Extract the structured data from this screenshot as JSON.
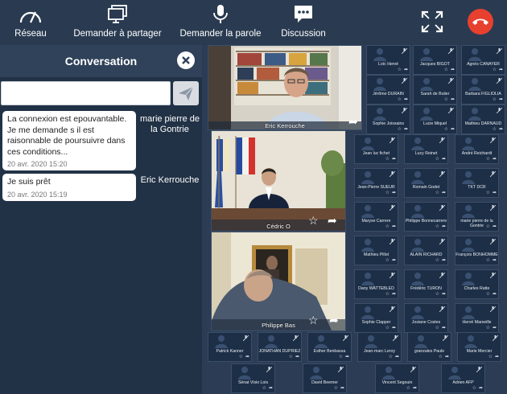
{
  "toolbar": {
    "network": "Réseau",
    "share": "Demander à partager",
    "speak": "Demander la parole",
    "discussion": "Discussion",
    "fullscreen_icon": "expand-icon",
    "hangup_icon": "hangup-phone-icon",
    "hangup_color": "#e8402f"
  },
  "chat": {
    "title": "Conversation",
    "input_value": "",
    "messages": [
      {
        "text": "La connexion est epouvantable. Je me demande s il est raisonnable de poursuivre dans ces conditions...",
        "time": "20 avr. 2020 15:20",
        "author": "marie pierre de la Gontrie"
      },
      {
        "text": "Je suis prêt",
        "time": "20 avr. 2020 15:19",
        "author": "Eric Kerrouche"
      }
    ]
  },
  "videos": {
    "featured": [
      {
        "name": "Eric Kerrouche"
      },
      {
        "name": "Cédric O"
      },
      {
        "name": "Philippe Bas"
      }
    ],
    "participants": [
      "Loïc Hervé",
      "Jacques BIGOT",
      "Agnès CANAYER",
      "Jérôme DURAIN",
      "Sarah de Bulier",
      "Barbara FIGLIOLIA",
      "Sophie Joissains",
      "Lucie Miquel",
      "Mathieu DARNAUD",
      "Jean luc fichet",
      "Lucy Reinet",
      "André Reichardt",
      "Jean-Pierre SUEUR",
      "Romain Godet",
      "TKT DCR",
      "Maryse Carrere",
      "Philippe Bonnecarrere",
      "marie pierre de la Gontrie",
      "Mathieu Pillot",
      "ALAIN RICHARD",
      "François BONHOMME",
      "Dany WATTEBLED",
      "Frédéric TURON",
      "Charles Ratte",
      "Sophie Clapper",
      "Josiane Costes",
      "Hervé Marseille",
      "Patrick Kanner",
      "JONATHAN DUPRIEZ",
      "Esther Benbassa",
      "Jean-marc Leroy",
      "granzales Paule",
      "Marie Mercier",
      "Sénat Visio Lois",
      "David Beemer",
      "Vincent Segouin",
      "Adrien AFP"
    ]
  }
}
